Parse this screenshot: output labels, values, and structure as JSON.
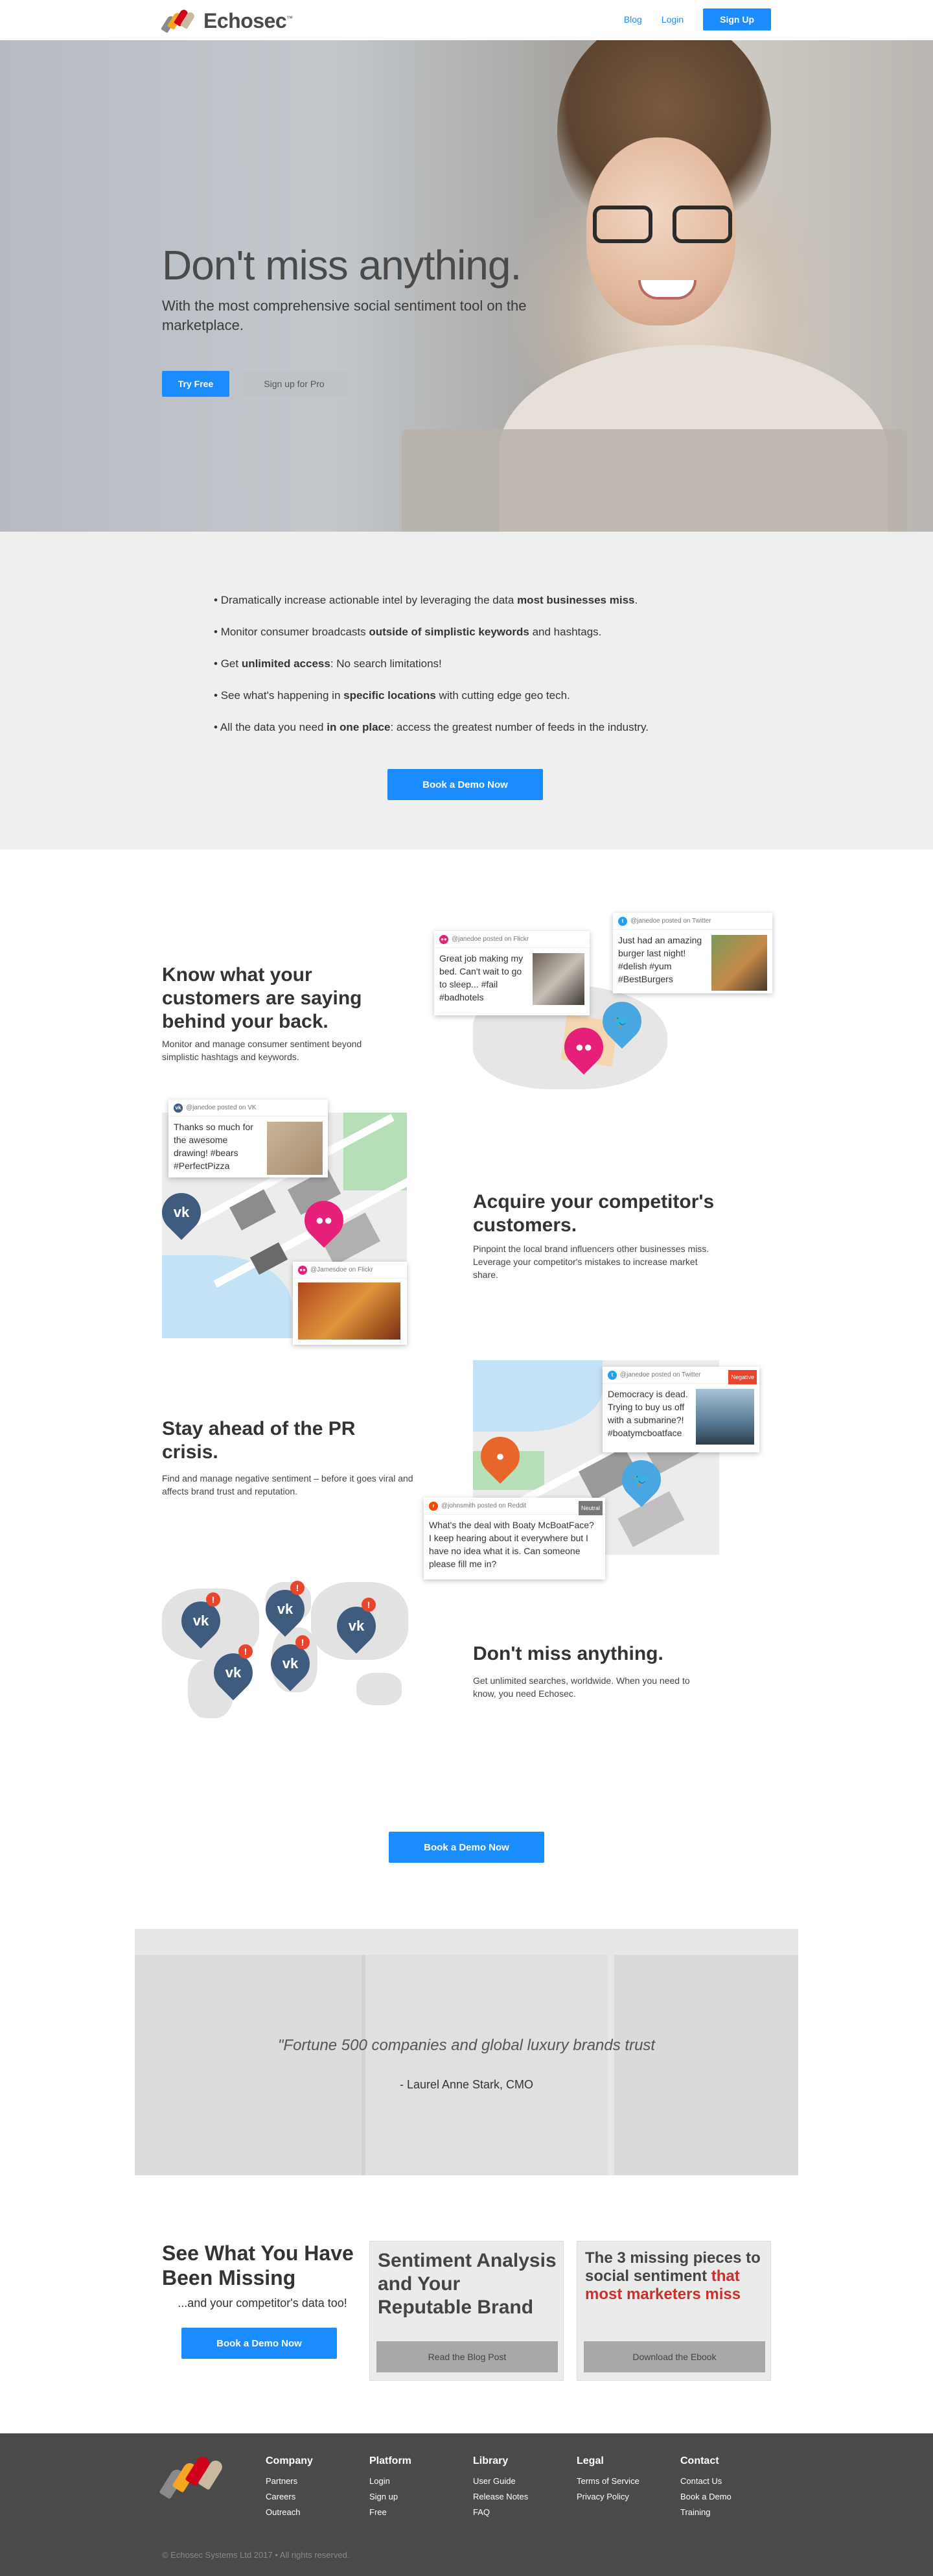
{
  "header": {
    "brand": "Echosec",
    "brand_mark": "™",
    "nav": {
      "blog": "Blog",
      "login": "Login",
      "signup": "Sign Up"
    }
  },
  "hero": {
    "title": "Don't miss anything.",
    "subtitle": "With the most comprehensive social sentiment tool on the marketplace.",
    "try_free": "Try Free",
    "signup_pro": "Sign up for Pro"
  },
  "benefits": {
    "items": [
      {
        "pre": "Dramatically increase actionable intel by leveraging the data ",
        "bold": "most businesses miss",
        "post": "."
      },
      {
        "pre": "Monitor consumer broadcasts ",
        "bold": "outside of simplistic keywords",
        "post": " and hashtags."
      },
      {
        "pre": "Get ",
        "bold": "unlimited access",
        "post": ": No search limitations!"
      },
      {
        "pre": "See what's happening in ",
        "bold": "specific locations",
        "post": " with cutting edge geo tech."
      },
      {
        "pre": "All the data you need ",
        "bold": "in one place",
        "post": ": access the greatest number of feeds in the industry."
      }
    ],
    "cta": "Book a Demo Now"
  },
  "features": {
    "f1": {
      "title": "Know what your customers are saying behind your back.",
      "text": "Monitor and manage consumer sentiment beyond simplistic hashtags and keywords.",
      "card_flickr": {
        "header": "@janedoe posted on Flickr",
        "text": "Great job making my bed. Can't wait to go to sleep... #fail #badhotels"
      },
      "card_twitter": {
        "header": "@janedoe posted on Twitter",
        "text": "Just had an amazing burger last night! #delish #yum #BestBurgers"
      }
    },
    "f2": {
      "title": "Acquire your competitor's customers.",
      "text": "Pinpoint the local brand influencers other businesses miss. Leverage your competitor's mistakes to increase market share.",
      "card_vk": {
        "header": "@janedoe posted on VK",
        "text": "Thanks so much for the awesome drawing! #bears #PerfectPizza"
      },
      "card_flickr": {
        "header": "@Jamesdoe on Flickr"
      }
    },
    "f3": {
      "title": "Stay ahead of the PR crisis.",
      "text": "Find and manage negative sentiment – before it goes viral and affects brand trust and reputation.",
      "card_twitter": {
        "header": "@janedoe posted on Twitter",
        "badge": "Negative",
        "text": "Democracy is dead. Trying to buy us off with a submarine?! #boatymcboatface"
      },
      "card_reddit": {
        "header": "@johnsmith posted on Reddit",
        "badge": "Neutral",
        "text": "What's the deal with Boaty McBoatFace? I keep hearing about it everywhere but I have no idea what it is. Can someone please fill me in?"
      }
    },
    "f4": {
      "title": "Don't miss anything.",
      "text": "Get unlimited searches, worldwide. When you need to know, you need Echosec."
    },
    "cta": "Book a Demo Now"
  },
  "quote": {
    "text": "\"Fortune 500 companies and global luxury brands trust",
    "author": "- Laurel Anne Stark, CMO"
  },
  "bottom": {
    "title": "See What You Have Been Missing",
    "sub": "...and your competitor's data too!",
    "cta": "Book a Demo Now",
    "blog_box": {
      "title": "Sentiment Analysis and Your Reputable Brand",
      "button": "Read the Blog Post"
    },
    "ebook_box": {
      "title_a": "The 3 missing pieces to social sentiment ",
      "title_b": "that most marketers miss",
      "button": "Download the Ebook"
    }
  },
  "footer": {
    "columns": [
      {
        "title": "Company",
        "links": [
          "Partners",
          "Careers",
          "Outreach"
        ]
      },
      {
        "title": "Platform",
        "links": [
          "Login",
          "Sign up",
          "Free"
        ]
      },
      {
        "title": "Library",
        "links": [
          "User Guide",
          "Release Notes",
          "FAQ"
        ]
      },
      {
        "title": "Legal",
        "links": [
          "Terms of Service",
          "Privacy Policy"
        ]
      },
      {
        "title": "Contact",
        "links": [
          "Contact Us",
          "Book a Demo",
          "Training"
        ]
      }
    ],
    "copyright": "© Echosec Systems Ltd 2017 • All rights reserved."
  },
  "colors": {
    "primary": "#1a8cff",
    "negative": "#e8452c",
    "footer": "#4a4a4a"
  },
  "icons": [
    "flickr-icon",
    "twitter-icon",
    "vk-icon",
    "reddit-icon",
    "alert-icon"
  ]
}
